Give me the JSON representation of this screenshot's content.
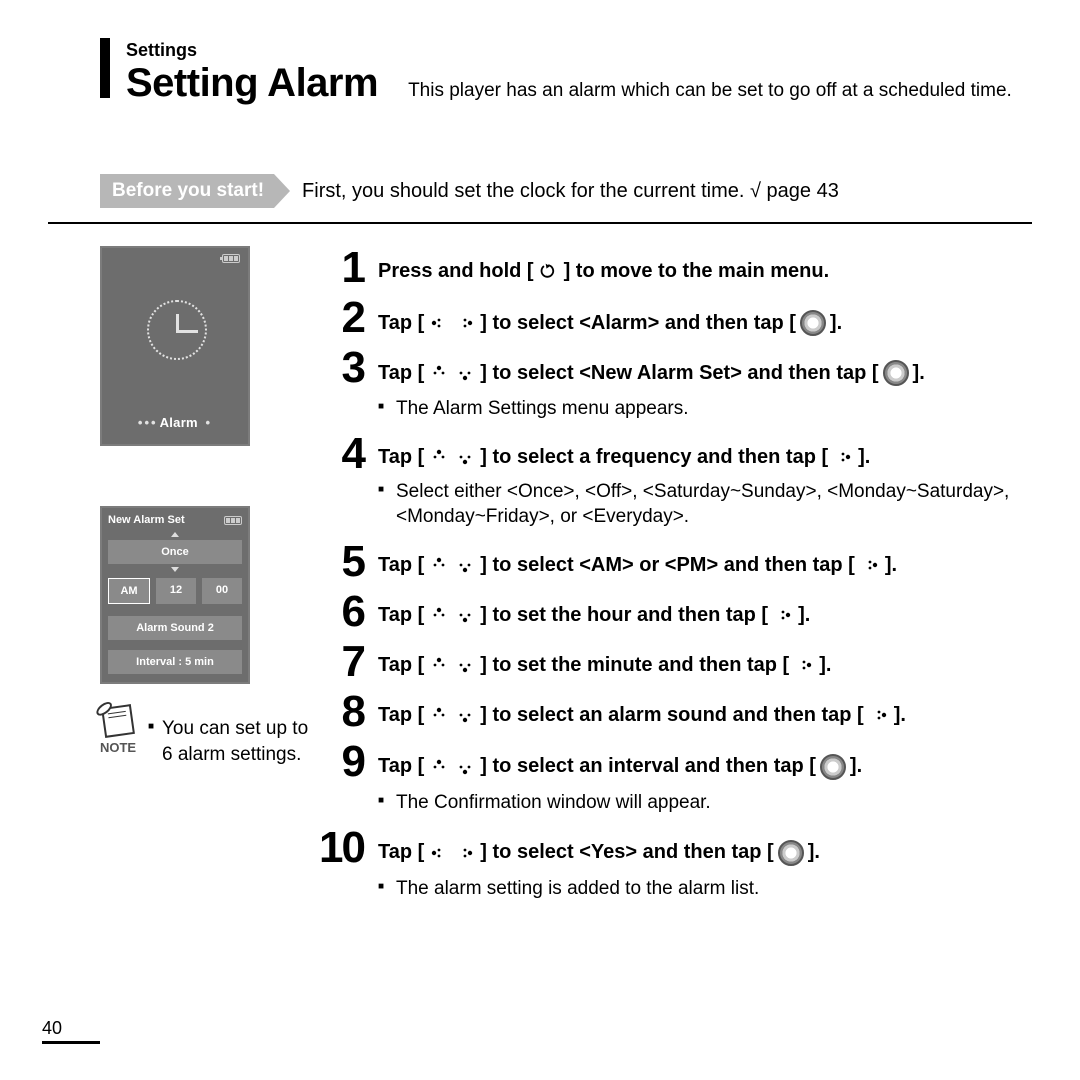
{
  "header": {
    "crumb": "Settings",
    "title": "Setting Alarm",
    "desc": "This player has an alarm which can be set to go off at a scheduled time."
  },
  "before": {
    "label": "Before you start!",
    "text": "First, you should set the clock for the current time. √ page 43"
  },
  "screens": {
    "alarm_label": "Alarm",
    "new_alarm_title": "New Alarm Set",
    "freq": "Once",
    "ampm": "AM",
    "hour": "12",
    "minute": "00",
    "sound": "Alarm Sound 2",
    "interval": "Interval : 5 min"
  },
  "note": {
    "label": "NOTE",
    "text": "You can set up to 6 alarm settings."
  },
  "steps": {
    "s1_a": "Press and hold [",
    "s1_b": "] to move to the main menu.",
    "s2_a": "Tap [",
    "s2_b": "] to select <Alarm> and then tap [",
    "s2_c": "].",
    "s3_a": "Tap [",
    "s3_b": "] to select <New Alarm Set> and then tap [",
    "s3_c": "].",
    "s3_sub": "The Alarm Settings menu appears.",
    "s4_a": "Tap [",
    "s4_b": "] to select a frequency and then tap [",
    "s4_c": "].",
    "s4_sub": "Select either <Once>, <Off>, <Saturday~Sunday>, <Monday~Saturday>, <Monday~Friday>, or <Everyday>.",
    "s5_a": "Tap [",
    "s5_b": "] to select <AM> or <PM> and then tap [",
    "s5_c": "].",
    "s6_a": "Tap [",
    "s6_b": "] to set the hour and then tap [",
    "s6_c": "].",
    "s7_a": "Tap [",
    "s7_b": "] to set the minute and then tap [",
    "s7_c": "].",
    "s8_a": "Tap [",
    "s8_b": "] to select an alarm sound and then tap [",
    "s8_c": "].",
    "s9_a": "Tap [",
    "s9_b": "] to select an interval and then tap [",
    "s9_c": "].",
    "s9_sub": "The Confirmation window will appear.",
    "s10_a": "Tap [",
    "s10_b": "] to select <Yes> and then tap [",
    "s10_c": "].",
    "s10_sub": "The alarm setting is added to the alarm list."
  },
  "page_number": "40"
}
